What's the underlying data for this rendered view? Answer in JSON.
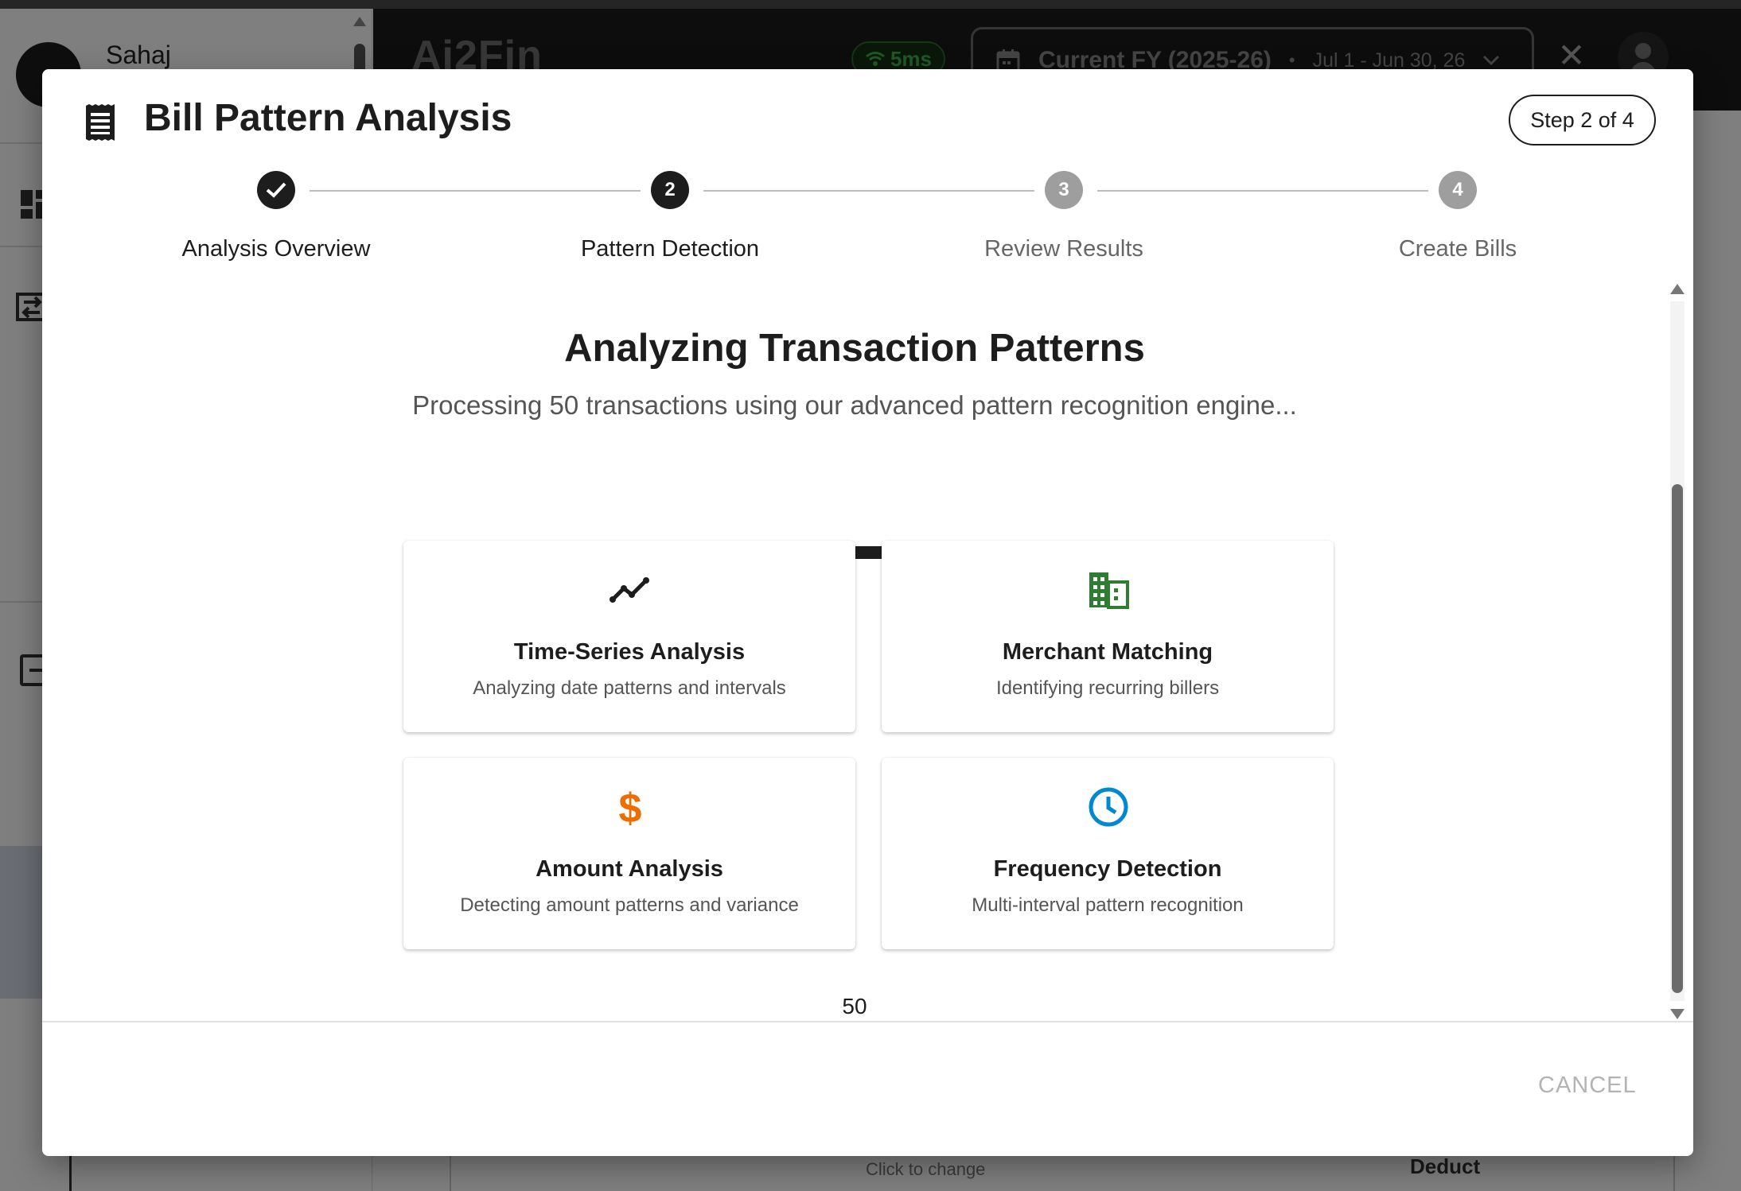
{
  "app": {
    "user_name": "Sahaj",
    "brand": "Ai2Fin",
    "latency": "5ms",
    "fy_selector": {
      "title": "Current FY (2025-26)",
      "separator": "•",
      "range": "Jul 1 - Jun 30, 26"
    },
    "background_hint": "Click to change",
    "background_action": "Deduct"
  },
  "dialog": {
    "title": "Bill Pattern Analysis",
    "step_badge": "Step 2 of 4",
    "steps": [
      {
        "number": "1",
        "label": "Analysis Overview",
        "state": "completed"
      },
      {
        "number": "2",
        "label": "Pattern Detection",
        "state": "active"
      },
      {
        "number": "3",
        "label": "Review Results",
        "state": "pending"
      },
      {
        "number": "4",
        "label": "Create Bills",
        "state": "pending"
      }
    ],
    "heading": "Analyzing Transaction Patterns",
    "subheading": "Processing 50 transactions using our advanced pattern recognition engine...",
    "progress": {
      "empty_fraction": 0.36,
      "fill_fraction": 0.64
    },
    "cards": [
      {
        "icon": "trending-line-icon",
        "icon_color": "#1d1d1d",
        "title": "Time-Series Analysis",
        "description": "Analyzing date patterns and intervals"
      },
      {
        "icon": "building-icon",
        "icon_color": "#2e7d32",
        "title": "Merchant Matching",
        "description": "Identifying recurring billers"
      },
      {
        "icon": "dollar-icon",
        "icon_color": "#ef6c00",
        "title": "Amount Analysis",
        "description": "Detecting amount patterns and variance"
      },
      {
        "icon": "clock-icon",
        "icon_color": "#0288d1",
        "title": "Frequency Detection",
        "description": "Multi-interval pattern recognition"
      }
    ],
    "transaction_count": "50",
    "cancel_label": "CANCEL"
  },
  "colors": {
    "primary": "#1d1d1d",
    "step_pending": "#9e9e9e",
    "success_green": "#2e7d32",
    "orange": "#ef6c00",
    "blue": "#0288d1"
  }
}
